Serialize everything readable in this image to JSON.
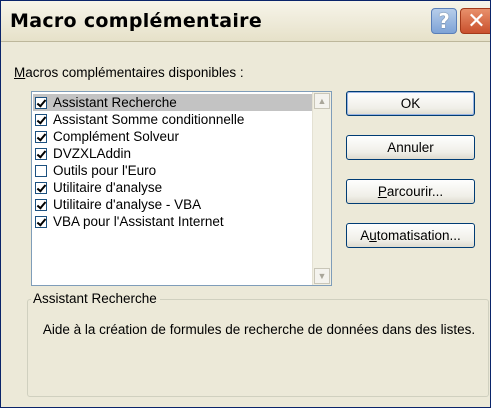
{
  "dialog": {
    "title": "Macro complémentaire",
    "help_glyph": "?",
    "close_glyph": "✕"
  },
  "list_label": {
    "mnemonic": "M",
    "rest": "acros complémentaires disponibles :"
  },
  "addins": [
    {
      "label": "Assistant Recherche",
      "checked": true,
      "selected": true
    },
    {
      "label": "Assistant Somme conditionnelle",
      "checked": true,
      "selected": false
    },
    {
      "label": "Complément Solveur",
      "checked": true,
      "selected": false
    },
    {
      "label": "DVZXLAddin",
      "checked": true,
      "selected": false
    },
    {
      "label": "Outils pour l'Euro",
      "checked": false,
      "selected": false
    },
    {
      "label": "Utilitaire d'analyse",
      "checked": true,
      "selected": false
    },
    {
      "label": "Utilitaire d'analyse - VBA",
      "checked": true,
      "selected": false
    },
    {
      "label": "VBA pour l'Assistant Internet",
      "checked": true,
      "selected": false
    }
  ],
  "buttons": {
    "ok": "OK",
    "cancel": "Annuler",
    "browse_mnemonic": "P",
    "browse_rest": "arcourir...",
    "automation_pre": "A",
    "automation_mnemonic": "u",
    "automation_rest": "tomatisation..."
  },
  "description": {
    "title": "Assistant Recherche",
    "text": "Aide à la création de formules de recherche de données dans des listes."
  },
  "icons": {
    "scroll_up": "scroll-up-arrow-icon",
    "scroll_down": "scroll-down-arrow-icon"
  }
}
